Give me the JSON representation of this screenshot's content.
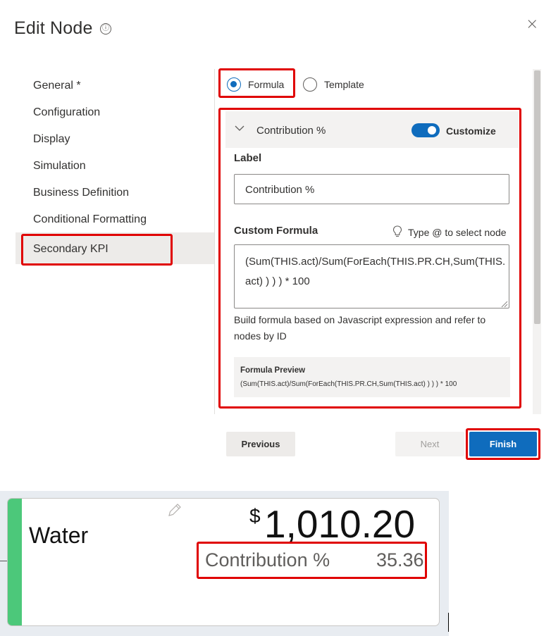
{
  "dialog": {
    "title": "Edit Node",
    "info_icon": "ⓘ",
    "close_icon": "×"
  },
  "nav": {
    "items": [
      {
        "label": "General *"
      },
      {
        "label": "Configuration"
      },
      {
        "label": "Display"
      },
      {
        "label": "Simulation"
      },
      {
        "label": "Business Definition"
      },
      {
        "label": "Conditional Formatting"
      },
      {
        "label": "Secondary KPI",
        "selected": true
      }
    ]
  },
  "mode": {
    "formula_label": "Formula",
    "template_label": "Template",
    "selected": "Formula"
  },
  "section": {
    "title": "Contribution %",
    "toggle_label": "Customize",
    "toggle_on": true
  },
  "label_field": {
    "heading": "Label",
    "value": "Contribution %"
  },
  "formula_field": {
    "heading": "Custom Formula",
    "hint": "Type @ to select node",
    "value_line1": "(Sum(THIS.act)/Sum(ForEach(THIS.PR.CH,Sum(THIS.",
    "value_line2": "act) ) ) ) * 100",
    "help": "Build formula based on Javascript expression and refer to nodes by ID"
  },
  "preview": {
    "heading": "Formula Preview",
    "value": "(Sum(THIS.act)/Sum(ForEach(THIS.PR.CH,Sum(THIS.act) ) ) ) * 100"
  },
  "buttons": {
    "previous": "Previous",
    "next": "Next",
    "finish": "Finish"
  },
  "card": {
    "name": "Water",
    "currency": "$",
    "amount": "1,010.20",
    "kpi_label": "Contribution %",
    "kpi_value": "35.36",
    "accent_color": "#4cc87a"
  },
  "colors": {
    "highlight": "#e00000",
    "primary": "#0f6cbd"
  }
}
